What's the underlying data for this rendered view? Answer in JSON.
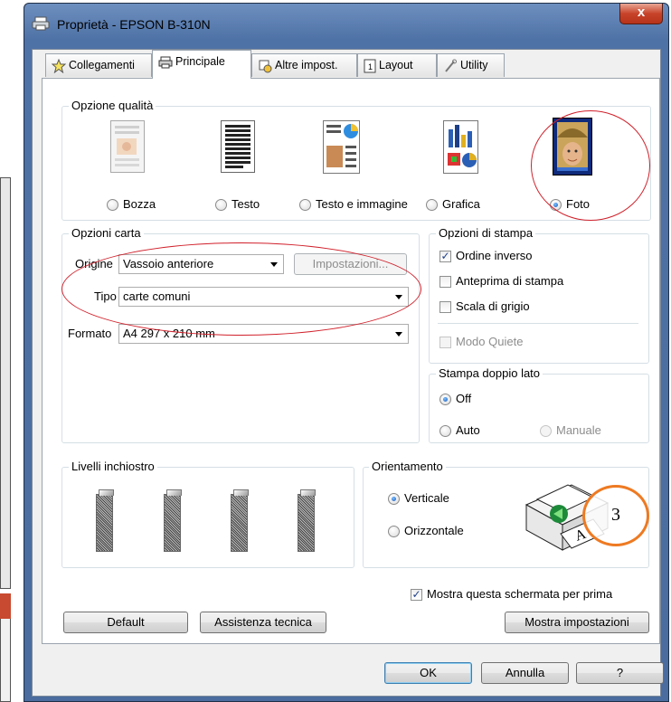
{
  "window": {
    "title": "Proprietà - EPSON B-310N",
    "close_label": "x"
  },
  "tabs": [
    {
      "label": "Collegamenti",
      "icon": "star-icon"
    },
    {
      "label": "Principale",
      "icon": "printer-icon"
    },
    {
      "label": "Altre impost.",
      "icon": "settings-icon"
    },
    {
      "label": "Layout",
      "icon": "page-layout-icon"
    },
    {
      "label": "Utility",
      "icon": "wrench-icon"
    }
  ],
  "quality": {
    "label": "Opzione qualità",
    "options": [
      "Bozza",
      "Testo",
      "Testo e immagine",
      "Grafica",
      "Foto"
    ],
    "selected": "Foto"
  },
  "paper": {
    "label": "Opzioni carta",
    "source_label": "Origine",
    "source_value": "Vassoio anteriore",
    "settings_button": "Impostazioni...",
    "type_label": "Tipo",
    "type_value": "carte comuni",
    "format_label": "Formato",
    "format_value": "A4 297 x 210 mm"
  },
  "print_options": {
    "label": "Opzioni di stampa",
    "reverse_order": "Ordine inverso",
    "reverse_order_checked": true,
    "preview": "Anteprima di stampa",
    "preview_checked": false,
    "grayscale": "Scala di grigio",
    "grayscale_checked": false,
    "quiet_mode": "Modo Quiete",
    "quiet_mode_checked": false
  },
  "duplex": {
    "label": "Stampa doppio lato",
    "options": [
      "Off",
      "Auto",
      "Manuale"
    ],
    "selected": "Off"
  },
  "ink": {
    "label": "Livelli inchiostro"
  },
  "orientation": {
    "label": "Orientamento",
    "options": [
      "Verticale",
      "Orizzontale"
    ],
    "selected": "Verticale"
  },
  "annotation_number": "3",
  "show_first": {
    "label": "Mostra questa schermata per prima",
    "checked": true
  },
  "buttons": {
    "default": "Default",
    "support": "Assistenza tecnica",
    "show_settings": "Mostra impostazioni",
    "ok": "OK",
    "cancel": "Annulla",
    "help": "?"
  },
  "colors": {
    "annotation_red": "#d0202a",
    "annotation_orange": "#ee7a22",
    "title_bar": "#5577aa"
  }
}
